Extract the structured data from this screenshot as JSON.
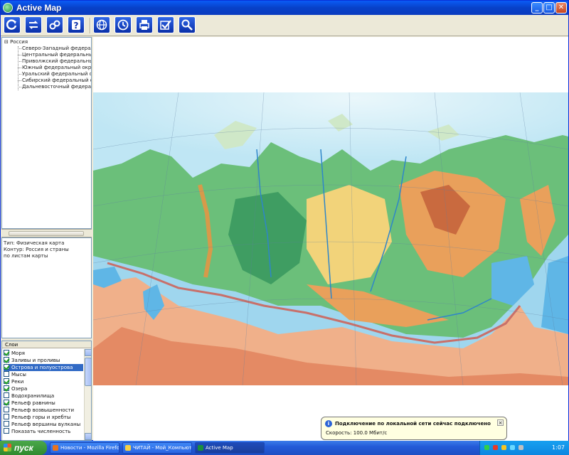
{
  "window": {
    "title": "Active Map",
    "minimize": "_",
    "maximize": "□",
    "close": "✕"
  },
  "toolbar": {
    "tools": [
      {
        "name": "refresh-tool",
        "icon": "refresh-icon"
      },
      {
        "name": "layers-tool",
        "icon": "layers-icon"
      },
      {
        "name": "find-tool",
        "icon": "binoculars-icon"
      },
      {
        "name": "help-tool",
        "icon": "help-icon",
        "label": "?"
      },
      {
        "name": "globe-tool",
        "icon": "globe-icon"
      },
      {
        "name": "clock-tool",
        "icon": "clock-icon"
      },
      {
        "name": "print-tool",
        "icon": "print-icon"
      },
      {
        "name": "check-tool",
        "icon": "check-icon"
      },
      {
        "name": "zoom-tool",
        "icon": "magnifier-icon"
      }
    ]
  },
  "tree": {
    "root": "⊟ Россия",
    "items": [
      "Северо-Западный федеральный",
      "Центральный федеральный окр",
      "Приволжский федеральный окр",
      "Южный федеральный округ",
      "Уральский федеральный округ",
      "Сибирский федеральный округ",
      "Дальневосточный федеральный"
    ]
  },
  "props": {
    "lines": [
      "Тип: Физическая карта",
      "Контур: Россия и страны",
      "по листам карты"
    ]
  },
  "layers": {
    "header": "Слои",
    "items": [
      {
        "label": "Моря",
        "checked": true,
        "selected": false
      },
      {
        "label": "Заливы и проливы",
        "checked": true,
        "selected": false
      },
      {
        "label": "Острова и полуострова",
        "checked": true,
        "selected": true
      },
      {
        "label": "Мысы",
        "checked": false,
        "selected": false
      },
      {
        "label": "Реки",
        "checked": true,
        "selected": false
      },
      {
        "label": "Озера",
        "checked": true,
        "selected": false
      },
      {
        "label": "Водохранилища",
        "checked": false,
        "selected": false
      },
      {
        "label": "Рельеф равнины",
        "checked": true,
        "selected": false
      },
      {
        "label": "Рельеф возвышенности",
        "checked": false,
        "selected": false
      },
      {
        "label": "Рельеф горы и хребты",
        "checked": false,
        "selected": false
      },
      {
        "label": "Рельеф вершины вулканы",
        "checked": false,
        "selected": false
      },
      {
        "label": "Показать численность",
        "checked": false,
        "selected": false
      }
    ]
  },
  "balloon": {
    "message": "Подключение по локальной сети сейчас подключено",
    "detail": "Скорость: 100.0 Мбит/с"
  },
  "taskbar": {
    "start": "пуск",
    "tasks": [
      {
        "label": "Новости - Mozilla Firefox",
        "color": "#e8731e",
        "active": false
      },
      {
        "label": "ЧИТАЙ - Мой_Компьютер",
        "color": "#f6d046",
        "active": false
      },
      {
        "label": "Active Map",
        "color": "#1a8f3d",
        "active": true
      }
    ],
    "clock": "1:07"
  },
  "colors": {
    "titlebar": "#0a5bf6",
    "selection": "#316ac5",
    "sea_deep": "#5fb6e6",
    "sea_shelf": "#bfe6f4",
    "lowland": "#6bbf7a",
    "upland": "#f2d37a",
    "mountains": "#e9a05b",
    "high_mountains": "#c96a3f",
    "border": "#c8706a"
  }
}
